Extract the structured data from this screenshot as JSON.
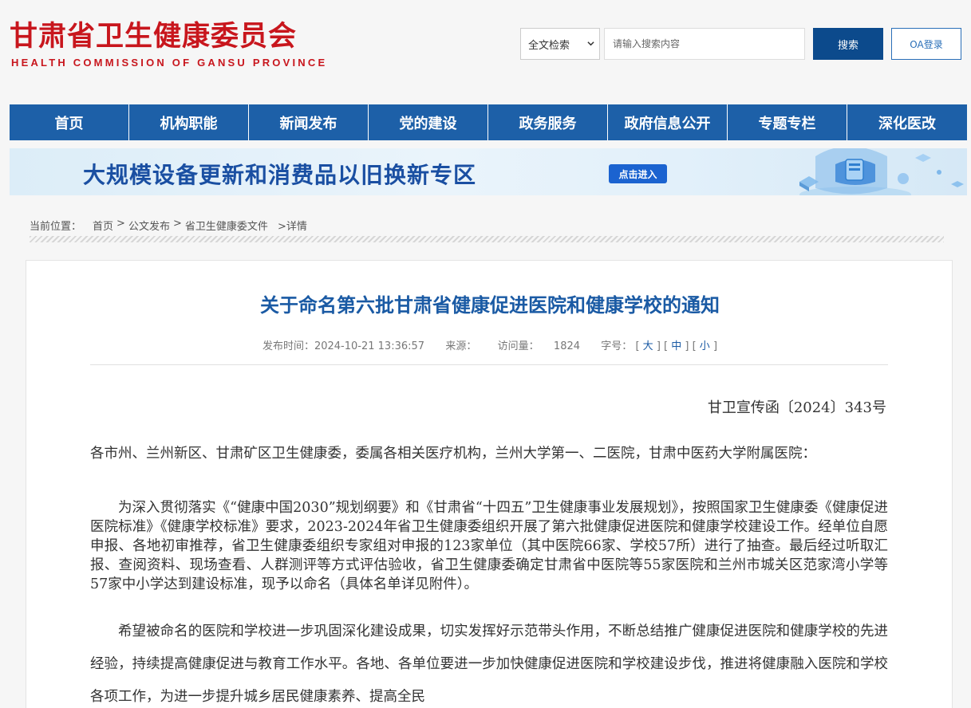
{
  "header": {
    "logo_cn": "甘肃省卫生健康委员会",
    "logo_en": "HEALTH COMMISSION OF GANSU PROVINCE",
    "search_scope": "全文检索",
    "search_placeholder": "请输入搜索内容",
    "search_button": "搜索",
    "oa_button": "OA登录"
  },
  "nav": {
    "items": [
      {
        "label": "首页"
      },
      {
        "label": "机构职能"
      },
      {
        "label": "新闻发布"
      },
      {
        "label": "党的建设"
      },
      {
        "label": "政务服务"
      },
      {
        "label": "政府信息公开"
      },
      {
        "label": "专题专栏"
      },
      {
        "label": "深化医改"
      }
    ]
  },
  "banner": {
    "title": "大规模设备更新和消费品以旧换新专区",
    "button": "点击进入"
  },
  "breadcrumb": {
    "label": "当前位置：",
    "items": [
      "首页",
      "公文发布",
      "省卫生健康委文件"
    ],
    "current": ">详情"
  },
  "article": {
    "title": "关于命名第六批甘肃省健康促进医院和健康学校的通知",
    "meta": {
      "publish_time": "发布时间：2024-10-21 13:36:57",
      "source": "来源：",
      "views_label": "访问量：",
      "views": "1824",
      "font_size_label": "字号：",
      "size_large": "大",
      "size_medium": "中",
      "size_small": "小"
    },
    "doc_number": "甘卫宣传函〔2024〕343号",
    "paragraphs": [
      "各市州、兰州新区、甘肃矿区卫生健康委，委属各相关医疗机构，兰州大学第一、二医院，甘肃中医药大学附属医院：",
      "为深入贯彻落实《“健康中国2030”规划纲要》和《甘肃省“十四五”卫生健康事业发展规划》，按照国家卫生健康委《健康促进医院标准》《健康学校标准》要求，2023-2024年省卫生健康委组织开展了第六批健康促进医院和健康学校建设工作。经单位自愿申报、各地初审推荐，省卫生健康委组织专家组对申报的123家单位（其中医院66家、学校57所）进行了抽查。最后经过听取汇报、查阅资料、现场查看、人群测评等方式评估验收，省卫生健康委确定甘肃省中医院等55家医院和兰州市城关区范家湾小学等57家中小学达到建设标准，现予以命名（具体名单详见附件）。",
      "希望被命名的医院和学校进一步巩固深化建设成果，切实发挥好示范带头作用，不断总结推广健康促进医院和健康学校的先进经验，持续提高健康促进与教育工作水平。各地、各单位要进一步加快健康促进医院和学校建设步伐，推进将健康融入医院和学校各项工作，为进一步提升城乡居民健康素养、提高全民"
    ]
  },
  "colors": {
    "brand_red": "#c8161d",
    "nav_blue": "#1d60a8",
    "title_blue": "#1a5aa4",
    "search_button": "#0c4a8c"
  }
}
